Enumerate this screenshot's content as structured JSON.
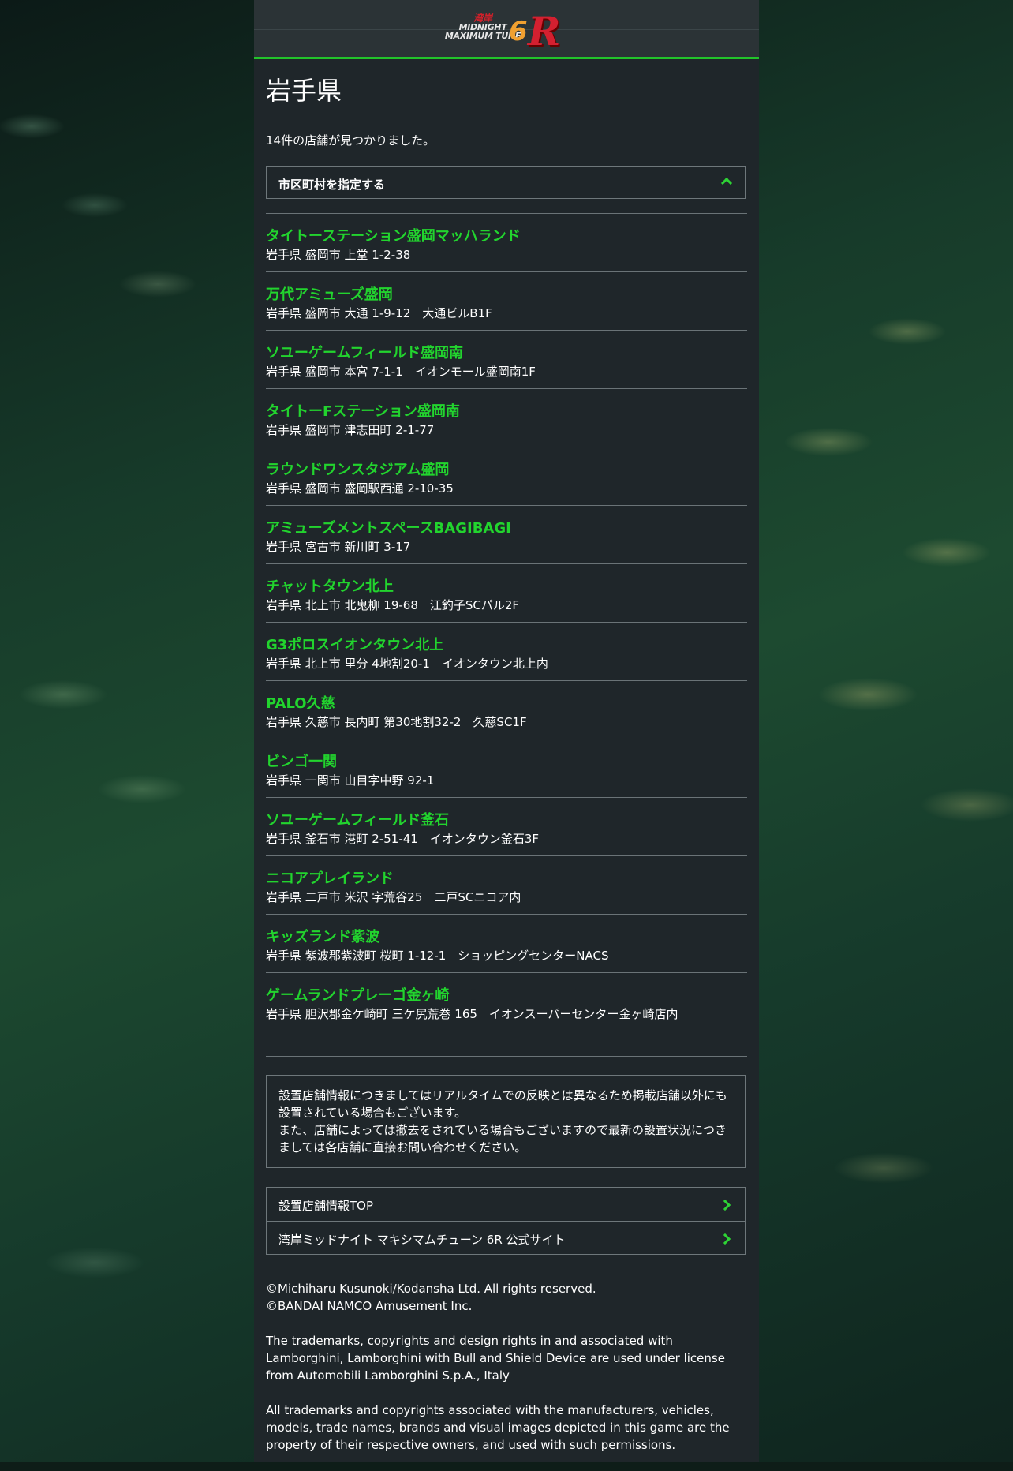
{
  "header": {
    "logo": {
      "line1": "湾岸",
      "line2": "MIDNIGHT",
      "line3": "MAXIMUM TUNE",
      "six": "6",
      "r": "R"
    }
  },
  "page": {
    "title": "岩手県",
    "result_count_text": "14件の店舗が見つかりました。"
  },
  "filter": {
    "label": "市区町村を指定する",
    "icon": "chevron-up-icon"
  },
  "stores": [
    {
      "name": "タイトーステーション盛岡マッハランド",
      "address": "岩手県 盛岡市 上堂 1-2-38"
    },
    {
      "name": "万代アミューズ盛岡",
      "address": "岩手県 盛岡市 大通 1-9-12　大通ビルB1F"
    },
    {
      "name": "ソユーゲームフィールド盛岡南",
      "address": "岩手県 盛岡市 本宮 7-1-1　イオンモール盛岡南1F"
    },
    {
      "name": "タイトーFステーション盛岡南",
      "address": "岩手県 盛岡市 津志田町 2-1-77"
    },
    {
      "name": "ラウンドワンスタジアム盛岡",
      "address": "岩手県 盛岡市 盛岡駅西通 2-10-35"
    },
    {
      "name": "アミューズメントスペースBAGIBAGI",
      "address": "岩手県 宮古市 新川町 3-17"
    },
    {
      "name": "チャットタウン北上",
      "address": "岩手県 北上市 北鬼柳 19-68　江釣子SCパル2F"
    },
    {
      "name": "G3ポロスイオンタウン北上",
      "address": "岩手県 北上市 里分 4地割20-1　イオンタウン北上内"
    },
    {
      "name": "PALO久慈",
      "address": "岩手県 久慈市 長内町 第30地割32-2　久慈SC1F"
    },
    {
      "name": "ビンゴ一関",
      "address": "岩手県 一関市 山目字中野 92-1"
    },
    {
      "name": "ソユーゲームフィールド釜石",
      "address": "岩手県 釜石市 港町 2-51-41　イオンタウン釜石3F"
    },
    {
      "name": "ニコアプレイランド",
      "address": "岩手県 二戸市 米沢 字荒谷25　二戸SCニコア内"
    },
    {
      "name": "キッズランド紫波",
      "address": "岩手県 紫波郡紫波町 桜町 1-12-1　ショッピングセンターNACS"
    },
    {
      "name": "ゲームランドプレーゴ金ヶ崎",
      "address": "岩手県 胆沢郡金ケ崎町 三ケ尻荒巻 165　イオンスーパーセンター金ヶ崎店内"
    }
  ],
  "notice": {
    "line1": "設置店舗情報につきましてはリアルタイムでの反映とは異なるため掲載店舗以外にも設置されている場合もございます。",
    "line2": "また、店舗によっては撤去をされている場合もございますので最新の設置状況につきましては各店舗に直接お問い合わせください。"
  },
  "links": [
    {
      "label": "設置店舗情報TOP",
      "icon": "chevron-right-icon"
    },
    {
      "label": "湾岸ミッドナイト マキシマムチューン 6R 公式サイト",
      "icon": "chevron-right-icon"
    }
  ],
  "footer": {
    "copyright1": "©Michiharu Kusunoki/Kodansha Ltd. All rights reserved.",
    "copyright2": "©BANDAI NAMCO Amusement Inc.",
    "lamborghini": "The trademarks, copyrights and design rights in and associated with Lamborghini, Lamborghini with Bull and Shield Device are used under license from Automobili Lamborghini S.p.A., Italy",
    "trademarks": "All trademarks and copyrights associated with the manufacturers, vehicles, models, trade names, brands and visual images depicted in this game are the property of their respective owners, and used with such permissions."
  },
  "colors": {
    "accent_green": "#22d42e",
    "panel_bg": "#1f262a",
    "header_bg": "#2b3336"
  }
}
